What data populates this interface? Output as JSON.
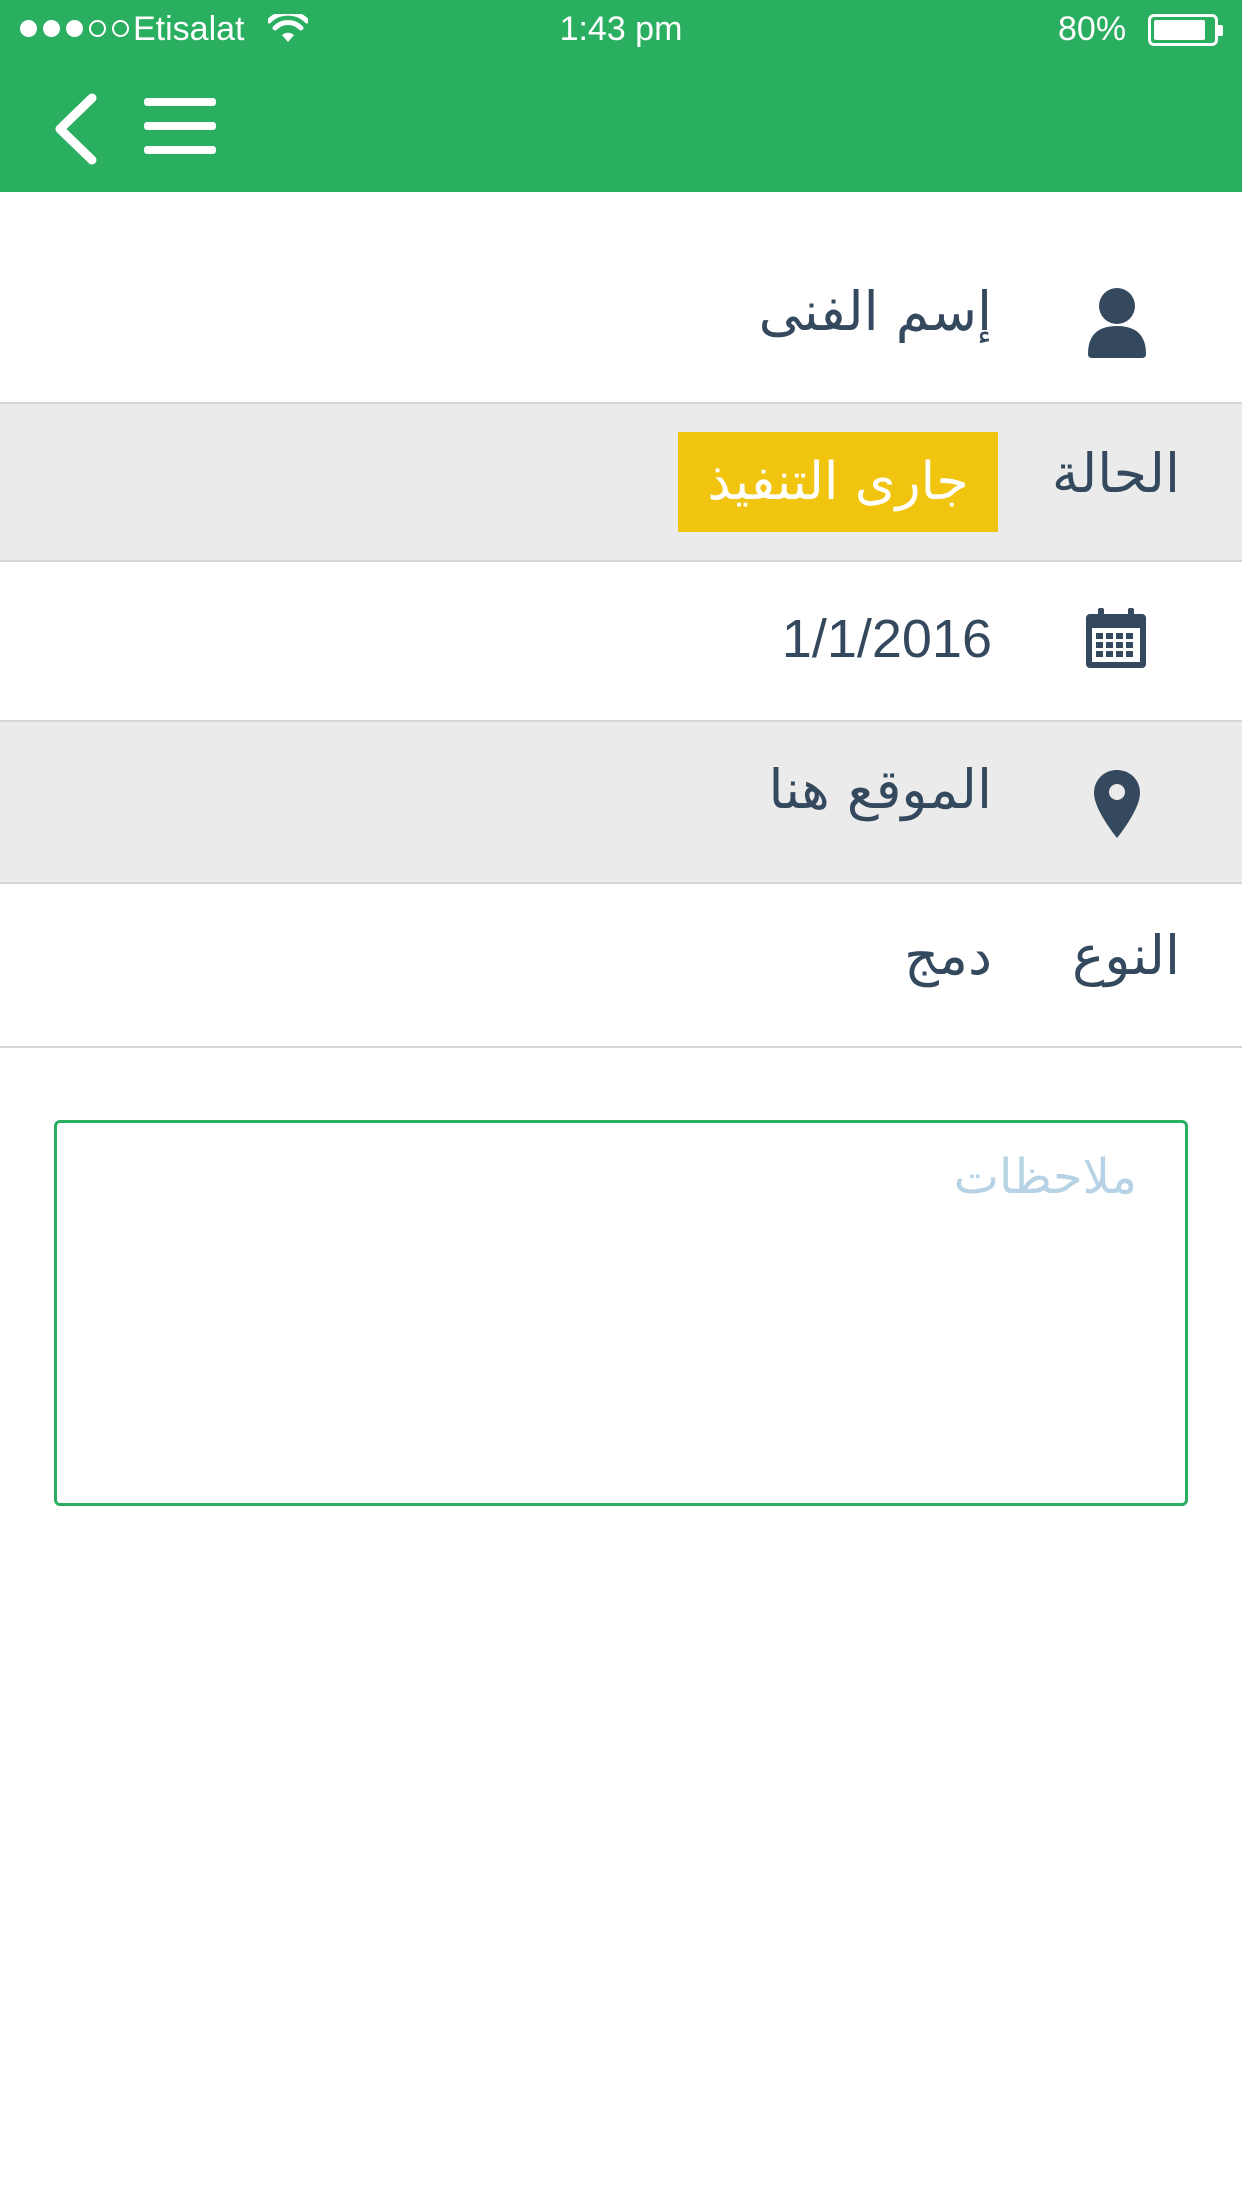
{
  "status_bar": {
    "carrier": "Etisalat",
    "time": "1:43 pm",
    "battery": "80%",
    "battery_level": 0.8,
    "signal_bars_filled": 3,
    "signal_bars_total": 5
  },
  "header": {
    "back_icon": "chevron-left-icon",
    "menu_icon": "hamburger-menu-icon",
    "background_color": "#2aae60"
  },
  "details": {
    "technician": {
      "icon": "user-icon",
      "value": "إسم الفنى"
    },
    "status": {
      "label": "الحالة",
      "value": "جارى التنفيذ",
      "badge_color": "#f1c40f"
    },
    "date": {
      "icon": "calendar-icon",
      "value": "1/1/2016"
    },
    "location": {
      "icon": "map-pin-icon",
      "value": "الموقع هنا"
    },
    "type": {
      "label": "النوع",
      "value": "دمج"
    }
  },
  "notes": {
    "placeholder": "ملاحظات",
    "border_color": "#2aae60"
  }
}
